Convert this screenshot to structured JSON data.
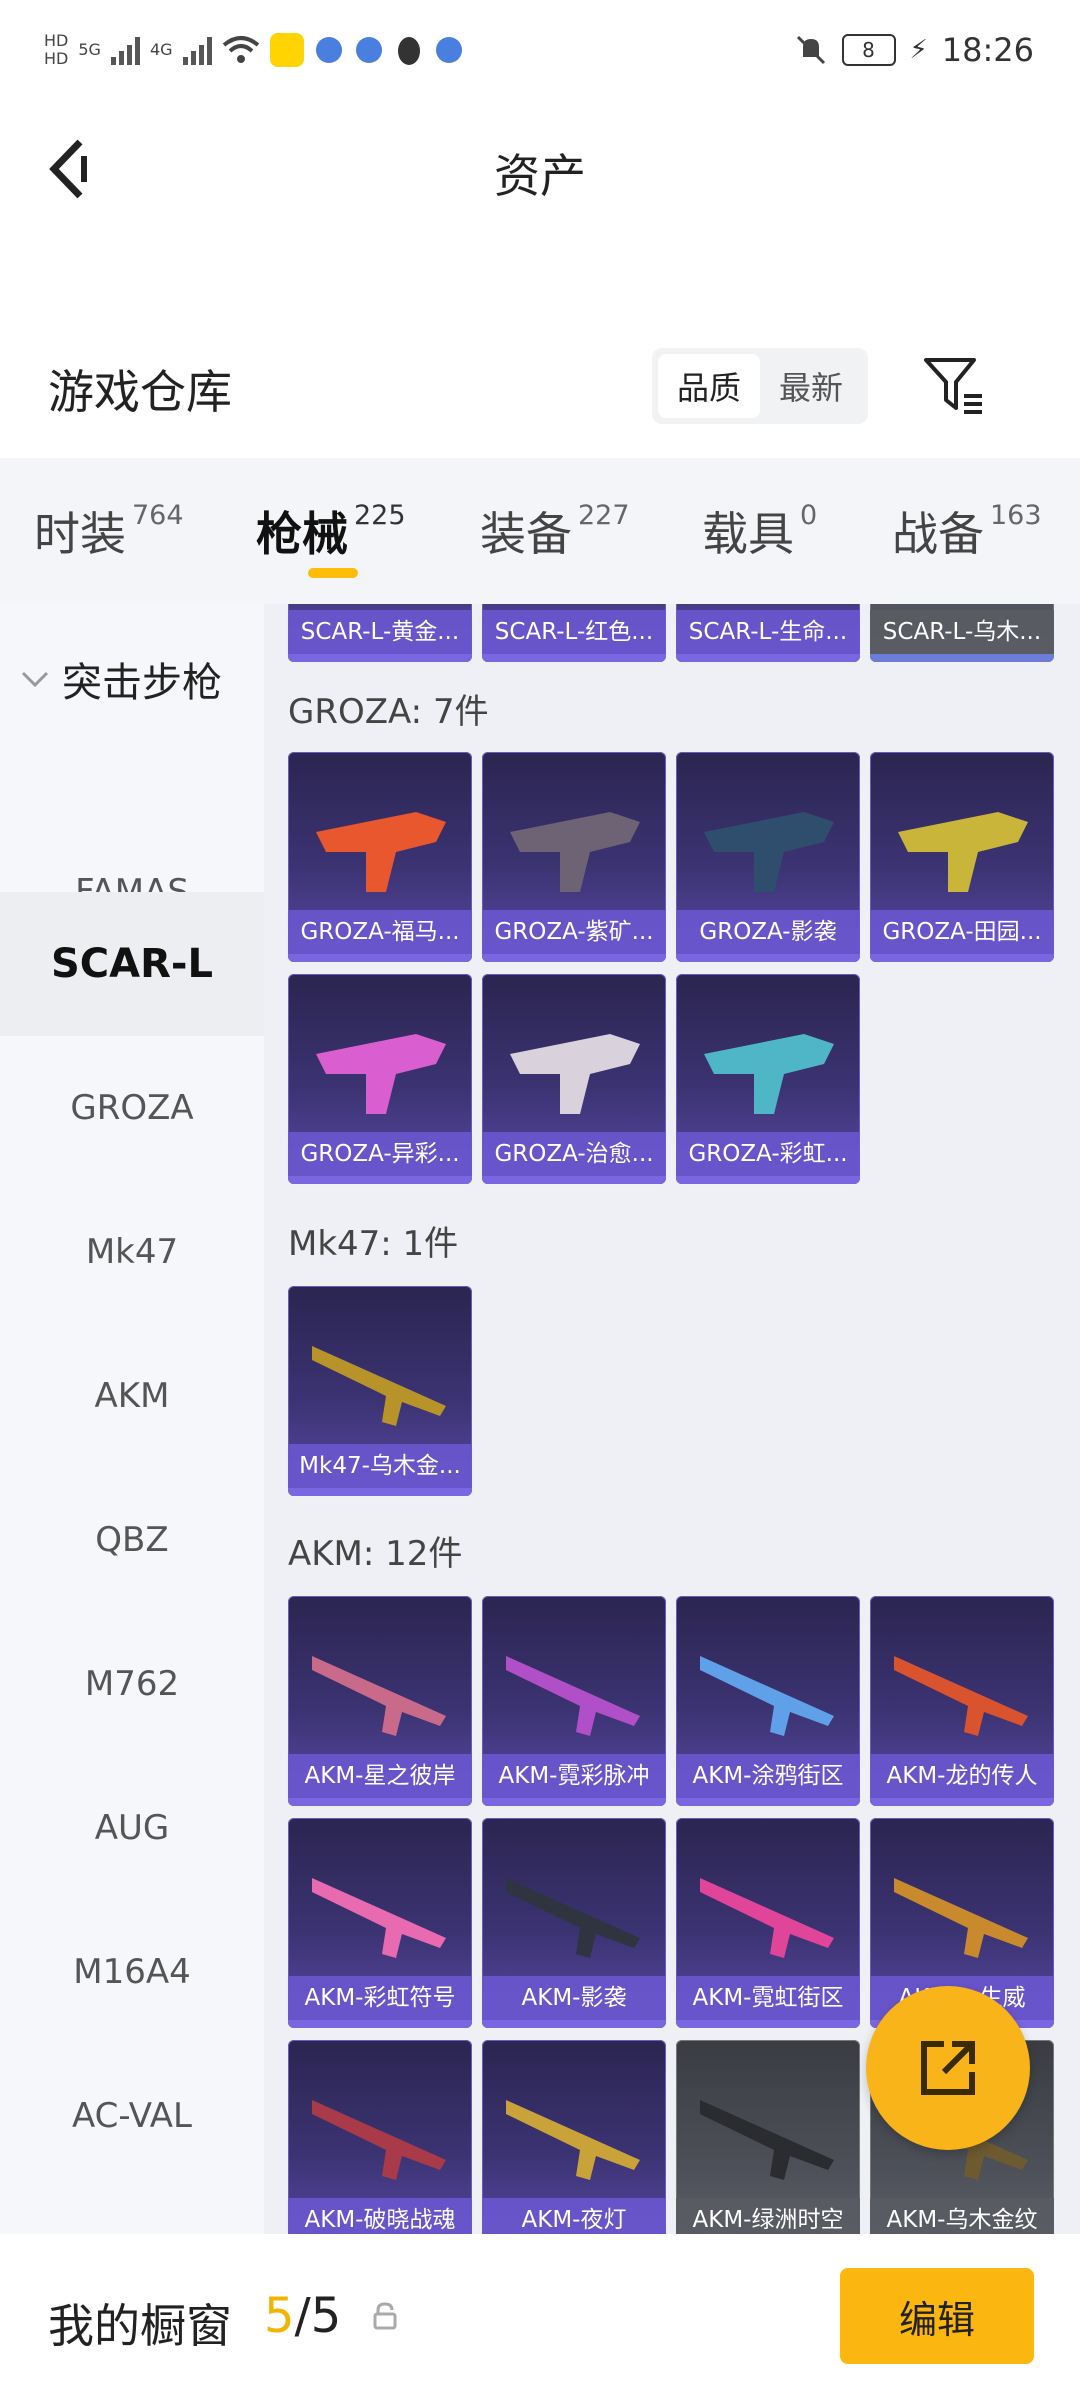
{
  "status_bar": {
    "time": "18:26",
    "battery": "8",
    "network_left": "5G",
    "network_right": "4G",
    "hd1": "HD",
    "hd2": "HD"
  },
  "header": {
    "title": "资产"
  },
  "warehouse": {
    "title": "游戏仓库",
    "sort_options": [
      "品质",
      "最新"
    ],
    "sort_selected": "品质"
  },
  "tabs": [
    {
      "label": "时装",
      "count": "764"
    },
    {
      "label": "枪械",
      "count": "225",
      "active": true
    },
    {
      "label": "装备",
      "count": "227"
    },
    {
      "label": "载具",
      "count": "0"
    },
    {
      "label": "战备",
      "count": "163"
    }
  ],
  "sidebar": {
    "category": "突击步枪",
    "items": [
      "FAMAS",
      "SCAR-L",
      "GROZA",
      "Mk47",
      "AKM",
      "QBZ",
      "M762",
      "AUG",
      "M16A4",
      "AC-VAL"
    ],
    "selected": "SCAR-L"
  },
  "content": {
    "top_row": [
      "SCAR-L-黄金...",
      "SCAR-L-红色...",
      "SCAR-L-生命...",
      "SCAR-L-乌木..."
    ],
    "groups": [
      {
        "title": "GROZA: 7件",
        "items": [
          "GROZA-福马...",
          "GROZA-紫矿...",
          "GROZA-影袭",
          "GROZA-田园...",
          "GROZA-异彩...",
          "GROZA-治愈...",
          "GROZA-彩虹..."
        ]
      },
      {
        "title": "Mk47: 1件",
        "items": [
          "Mk47-乌木金..."
        ]
      },
      {
        "title": "AKM: 12件",
        "items": [
          "AKM-星之彼岸",
          "AKM-霓彩脉冲",
          "AKM-涂鸦街区",
          "AKM-龙的传人",
          "AKM-彩虹符号",
          "AKM-影袭",
          "AKM-霓虹街区",
          "AKM-...生威",
          "AKM-破晓战魂",
          "AKM-夜灯",
          "AKM-绿洲时空",
          "AKM-乌木金纹"
        ]
      }
    ]
  },
  "bottom_bar": {
    "title": "我的橱窗",
    "count_current": "5",
    "count_sep": "/",
    "count_total": "5",
    "edit_label": "编辑"
  },
  "colors": {
    "accent": "#fbb60f",
    "card_purple": "#3c3373",
    "card_gray": "#4d5058"
  }
}
